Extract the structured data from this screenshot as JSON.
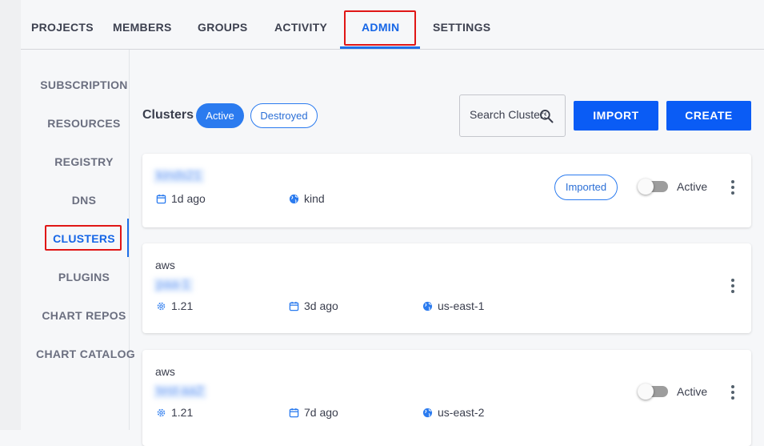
{
  "top_nav": {
    "tabs": [
      {
        "label": "PROJECTS",
        "active": false
      },
      {
        "label": "MEMBERS",
        "active": false
      },
      {
        "label": "GROUPS",
        "active": false
      },
      {
        "label": "ACTIVITY",
        "active": false
      },
      {
        "label": "ADMIN",
        "active": true
      },
      {
        "label": "SETTINGS",
        "active": false
      }
    ]
  },
  "side_nav": {
    "items": [
      {
        "label": "SUBSCRIPTION",
        "active": false
      },
      {
        "label": "RESOURCES",
        "active": false
      },
      {
        "label": "REGISTRY",
        "active": false
      },
      {
        "label": "DNS",
        "active": false
      },
      {
        "label": "CLUSTERS",
        "active": true
      },
      {
        "label": "PLUGINS",
        "active": false
      },
      {
        "label": "CHART REPOS",
        "active": false
      },
      {
        "label": "CHART CATALOG",
        "active": false
      }
    ]
  },
  "clusters": {
    "title": "Clusters",
    "filters": [
      {
        "label": "Active",
        "selected": true
      },
      {
        "label": "Destroyed",
        "selected": false
      }
    ],
    "search": {
      "placeholder": "Search Clusters",
      "value": ""
    },
    "import_label": "IMPORT",
    "create_label": "CREATE",
    "items": [
      {
        "name": "kinds21",
        "name_redacted": true,
        "age": "1d ago",
        "location": "kind",
        "badge": "Imported",
        "toggle_label": "Active",
        "toggle_on": false
      },
      {
        "provider": "aws",
        "name": "paa-1",
        "name_redacted": true,
        "version": "1.21",
        "age": "3d ago",
        "region": "us-east-1"
      },
      {
        "provider": "aws",
        "name": "test-aa2",
        "name_redacted": true,
        "version": "1.21",
        "age": "7d ago",
        "region": "us-east-2",
        "toggle_label": "Active",
        "toggle_on": false
      }
    ]
  },
  "colors": {
    "accent": "#1565e6",
    "button": "#0a5cf5",
    "highlight_box": "#e01616"
  },
  "icons": {
    "search": "search-icon",
    "calendar": "calendar-icon",
    "globe": "globe-icon",
    "settings": "gear-icon",
    "more": "more-vertical-icon"
  }
}
